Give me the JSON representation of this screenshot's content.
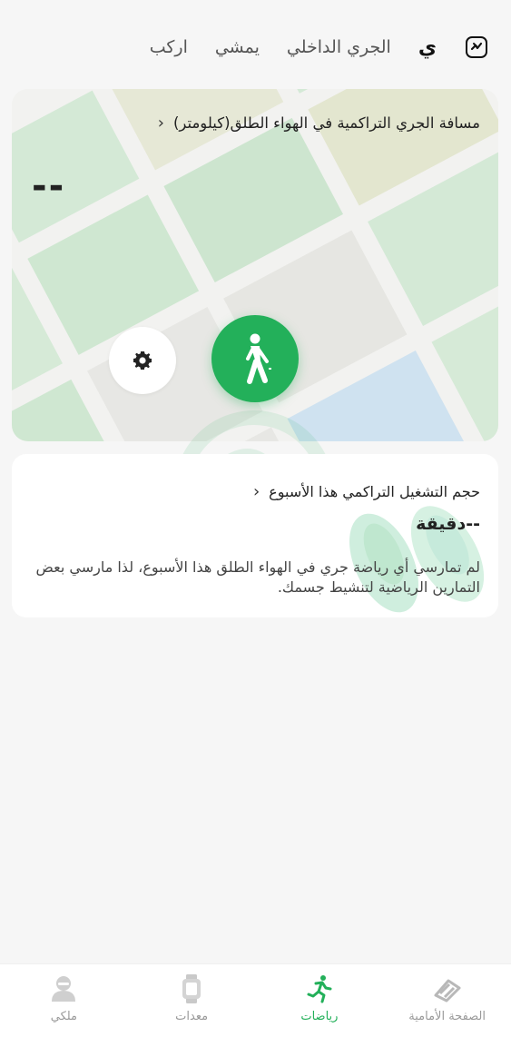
{
  "top_tabs": {
    "items": [
      {
        "label": "ي",
        "active": true
      },
      {
        "label": "الجري الداخلي",
        "active": false
      },
      {
        "label": "يمشي",
        "active": false
      },
      {
        "label": "اركب",
        "active": false
      }
    ],
    "icon": "run-outdoor-icon"
  },
  "map_card": {
    "title": "مسافة الجري التراكمية في الهواء الطلق(كيلومتر)",
    "value": "--",
    "chevron_icon": "chevron-left-icon",
    "settings_icon": "gear-icon",
    "start_icon": "walking-figure-icon"
  },
  "week_card": {
    "title": "حجم التشغيل التراكمي هذا الأسبوع",
    "value": "--دقيقة",
    "note": "لم تمارسي أي رياضة جري في الهواء الطلق هذا الأسبوع، لذا مارسي بعض التمارين الرياضية لتنشيط جسمك.",
    "chevron_icon": "chevron-left-icon"
  },
  "bottom_nav": {
    "items": [
      {
        "label": "الصفحة الأمامية",
        "icon": "home-stripes-icon",
        "active": false
      },
      {
        "label": "رياضات",
        "icon": "running-person-icon",
        "active": true
      },
      {
        "label": "معدات",
        "icon": "watch-icon",
        "active": false
      },
      {
        "label": "ملكي",
        "icon": "profile-icon",
        "active": false
      }
    ]
  },
  "colors": {
    "accent": "#23b05a",
    "background": "#f6f6f6",
    "map_green": "#cfe6cf",
    "map_tan": "#e3e6cf",
    "map_blue": "#cfe2f0"
  }
}
